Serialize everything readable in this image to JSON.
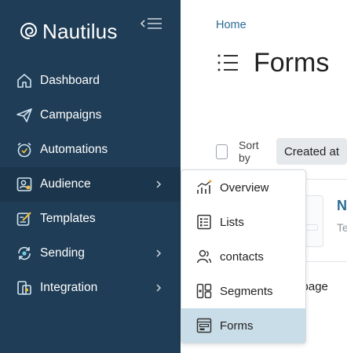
{
  "app": {
    "name": "Nautilus",
    "colors": {
      "sidebar": "#1f3d56",
      "accent": "#2b6c96",
      "submenu_active": "#c9dde8"
    }
  },
  "sidebar": {
    "items": [
      {
        "label": "Dashboard",
        "icon": "home-icon"
      },
      {
        "label": "Campaigns",
        "icon": "paper-plane-icon"
      },
      {
        "label": "Automations",
        "icon": "alarm-clock-icon"
      },
      {
        "label": "Audience",
        "icon": "audience-icon",
        "has_submenu": true
      },
      {
        "label": "Templates",
        "icon": "edit-template-icon"
      },
      {
        "label": "Sending",
        "icon": "sync-icon",
        "has_submenu": true
      },
      {
        "label": "Integration",
        "icon": "integration-icon",
        "has_submenu": true
      }
    ]
  },
  "submenu": {
    "items": [
      {
        "label": "Overview",
        "icon": "chart-icon"
      },
      {
        "label": "Lists",
        "icon": "list-icon"
      },
      {
        "label": "contacts",
        "icon": "contacts-icon"
      },
      {
        "label": "Segments",
        "icon": "segments-icon"
      },
      {
        "label": "Forms",
        "icon": "forms-icon",
        "active": true
      }
    ]
  },
  "main": {
    "breadcrumb": "Home",
    "title": "Forms",
    "sort_label": "Sort by",
    "sort_value": "Created at",
    "item_letter": "N",
    "item_sub": "Te",
    "per_page": "er page"
  }
}
